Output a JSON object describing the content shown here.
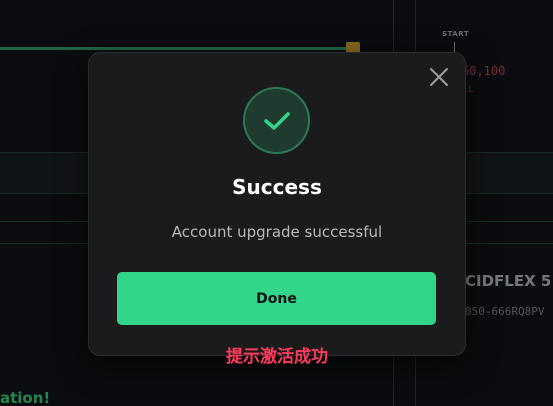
{
  "background": {
    "start_label": "START",
    "price": "60,100",
    "price_sub": "LL",
    "product_name": "CIDFLEX 5",
    "product_code": "050-666RQ8PV",
    "bottom_text": "ation!"
  },
  "modal": {
    "title": "Success",
    "message": "Account upgrade successful",
    "done_label": "Done",
    "annotation": "提示激活成功",
    "accent_color": "#31d68a"
  },
  "icons": {
    "close": "close-icon",
    "check": "check-icon"
  }
}
